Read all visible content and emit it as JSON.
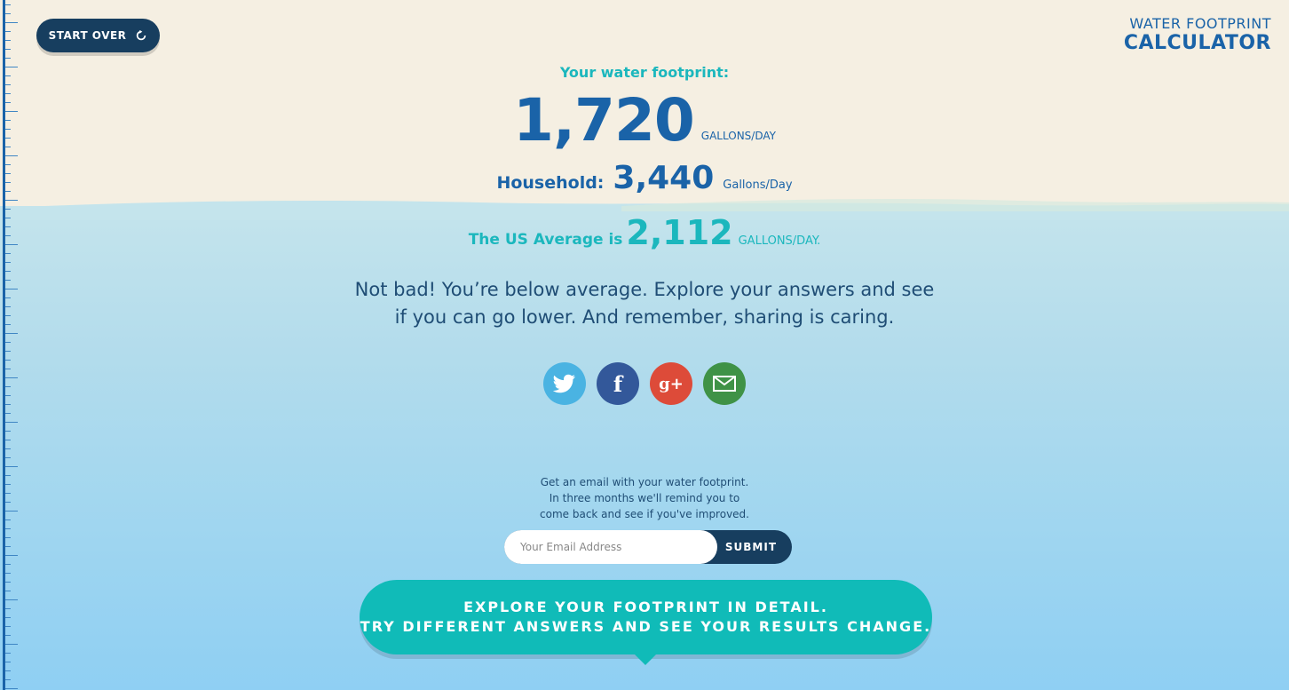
{
  "header": {
    "start_over_label": "START OVER",
    "brand_line1": "WATER FOOTPRINT",
    "brand_line2": "CALCULATOR"
  },
  "results": {
    "your_footprint_label": "Your water footprint:",
    "personal_value": "1,720",
    "personal_unit": "GALLONS/DAY",
    "household_label": "Household:",
    "household_value": "3,440",
    "household_unit": "Gallons/Day",
    "us_average_label": "The US Average is",
    "us_average_value": "2,112",
    "us_average_unit": "GALLONS/DAY.",
    "message_line1": "Not bad! You’re below average. Explore your answers and see",
    "message_line2": "if you can go lower. And remember, sharing is caring."
  },
  "share": {
    "icons": [
      "twitter-icon",
      "facebook-icon",
      "google-plus-icon",
      "email-icon"
    ],
    "facebook_glyph": "f",
    "google_glyph": "g+"
  },
  "email_signup": {
    "line1": "Get an email with your water footprint.",
    "line2": "In three months we'll remind you to",
    "line3": "come back and see if you've improved.",
    "placeholder": "Your Email Address",
    "submit_label": "SUBMIT"
  },
  "explore": {
    "line1": "EXPLORE YOUR FOOTPRINT IN DETAIL.",
    "line2": "TRY DIFFERENT ANSWERS AND SEE YOUR RESULTS CHANGE."
  },
  "colors": {
    "primary_blue": "#1a63a8",
    "teal": "#1bb7bd",
    "navy": "#173e5f",
    "twitter": "#4ab3e2",
    "facebook": "#33589a",
    "google": "#dd4b39",
    "email": "#3f9246"
  }
}
